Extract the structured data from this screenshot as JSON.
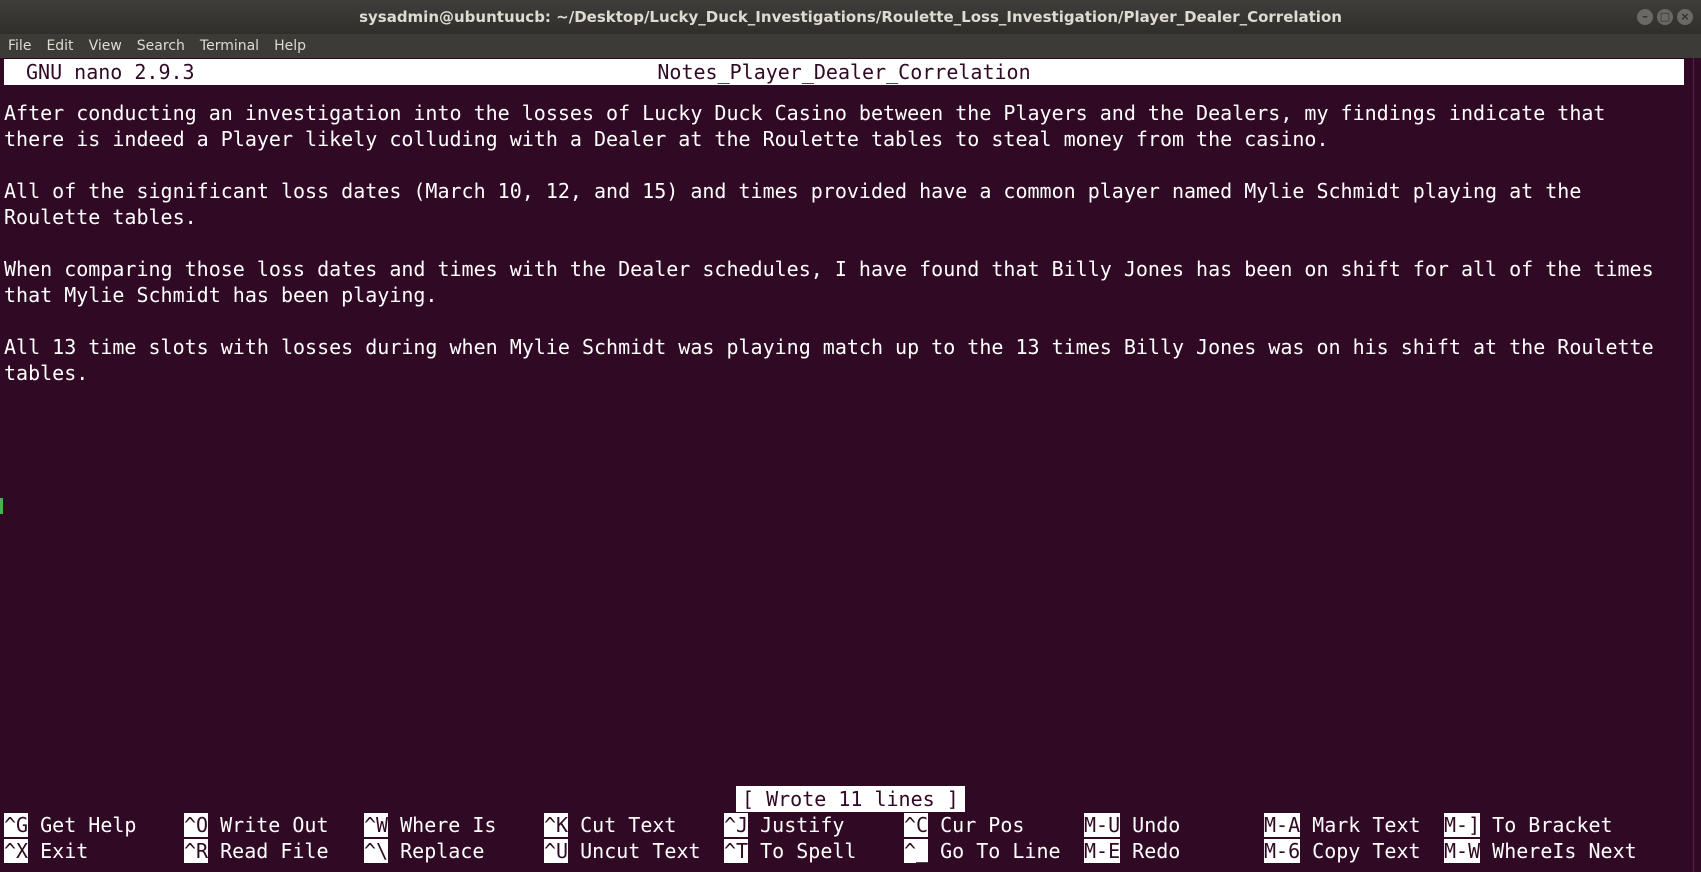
{
  "window": {
    "title": "sysadmin@ubuntuucb: ~/Desktop/Lucky_Duck_Investigations/Roulette_Loss_Investigation/Player_Dealer_Correlation"
  },
  "menu": [
    "File",
    "Edit",
    "View",
    "Search",
    "Terminal",
    "Help"
  ],
  "nano": {
    "version": "GNU nano 2.9.3",
    "filename": "Notes_Player_Dealer_Correlation",
    "lines": [
      "After conducting an investigation into the losses of Lucky Duck Casino between the Players and the Dealers, my findings indicate that",
      "there is indeed a Player likely colluding with a Dealer at the Roulette tables to steal money from the casino.",
      "",
      "All of the significant loss dates (March 10, 12, and 15) and times provided have a common player named Mylie Schmidt playing at the",
      "Roulette tables.",
      "",
      "When comparing those loss dates and times with the Dealer schedules, I have found that Billy Jones has been on shift for all of the times",
      "that Mylie Schmidt has been playing.",
      "",
      "All 13 time slots with losses during when Mylie Schmidt was playing match up to the 13 times Billy Jones was on his shift at the Roulette",
      "tables."
    ],
    "status": "[ Wrote 11 lines ]",
    "shortcuts_row1": [
      {
        "key": "^G",
        "label": "Get Help"
      },
      {
        "key": "^O",
        "label": "Write Out"
      },
      {
        "key": "^W",
        "label": "Where Is"
      },
      {
        "key": "^K",
        "label": "Cut Text"
      },
      {
        "key": "^J",
        "label": "Justify"
      },
      {
        "key": "^C",
        "label": "Cur Pos"
      },
      {
        "key": "M-U",
        "label": "Undo"
      },
      {
        "key": "M-A",
        "label": "Mark Text"
      },
      {
        "key": "M-]",
        "label": "To Bracket"
      }
    ],
    "shortcuts_row2": [
      {
        "key": "^X",
        "label": "Exit"
      },
      {
        "key": "^R",
        "label": "Read File"
      },
      {
        "key": "^\\",
        "label": "Replace"
      },
      {
        "key": "^U",
        "label": "Uncut Text"
      },
      {
        "key": "^T",
        "label": "To Spell"
      },
      {
        "key": "^_",
        "label": "Go To Line"
      },
      {
        "key": "M-E",
        "label": "Redo"
      },
      {
        "key": "M-6",
        "label": "Copy Text"
      },
      {
        "key": "M-W",
        "label": "WhereIs Next"
      }
    ]
  },
  "colors": {
    "terminal_bg": "#300a24",
    "terminal_fg": "#ffffff",
    "titlebar_bg": "#3c3b37"
  }
}
